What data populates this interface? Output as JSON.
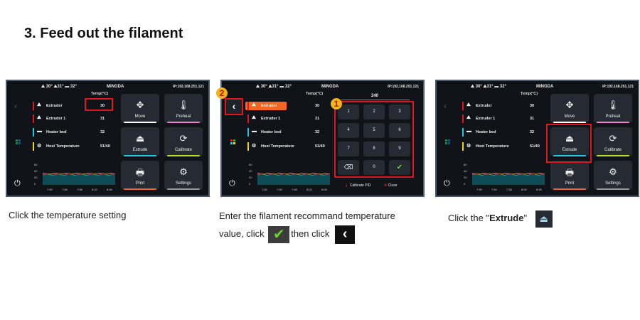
{
  "heading": "3.  Feed out the filament",
  "colors": {
    "screen_bg": "#101317",
    "tile_bg": "#262b33",
    "highlight": "#e0161e",
    "orange": "#f26522",
    "marker": "#f1b41a"
  },
  "screen": {
    "temps": "⛰ 30° ⛰31° ▬ 32°",
    "brand": "MINGDA",
    "ip": "IP:192.168.251.121",
    "temp_header": "Temp(°C)",
    "rows": [
      {
        "label": "Extruder",
        "value": "30",
        "bar_color": "#e0161e",
        "icon": "extruder-icon"
      },
      {
        "label": "Extruder 1",
        "value": "31",
        "bar_color": "#e0161e",
        "icon": "extruder-icon"
      },
      {
        "label": "Heater bed",
        "value": "32",
        "bar_color": "#1bc6e6",
        "icon": "heater-bed-icon"
      },
      {
        "label": "Host Temperature",
        "value": "51/40",
        "bar_color": "#f2d21a",
        "icon": "gear-icon"
      }
    ],
    "chart_y_ticks": [
      "60",
      "40",
      "20",
      "0"
    ],
    "chart_x_ticks": [
      "7:50",
      "7:54",
      "7:58",
      "8:02",
      "8:06"
    ],
    "tiles": [
      {
        "label": "Move",
        "color": "#ffffff"
      },
      {
        "label": "Preheat",
        "color": "#ee7fd0"
      },
      {
        "label": "Extrude",
        "color": "#1bc6e6"
      },
      {
        "label": "Calibrate",
        "color": "#b3e21a"
      },
      {
        "label": "Print",
        "color": "#f26522"
      },
      {
        "label": "Settings",
        "color": "#9b9b9b"
      }
    ]
  },
  "screen2": {
    "entry_value": "240",
    "keys": [
      "1",
      "2",
      "3",
      "4",
      "5",
      "6",
      "7",
      "8",
      "9",
      "⌫",
      "0",
      "✔"
    ],
    "calibrate_pid": "Calibrate PID",
    "close": "Close",
    "marker1": "1",
    "marker2": "2"
  },
  "captions": {
    "c1": "Click the temperature setting",
    "c2_line1": "Enter the filament recommand temperature",
    "c2_line2a": "value, click",
    "c2_line2b": "then click",
    "c3_prefix": "Click the \"",
    "c3_bold": "Extrude",
    "c3_suffix": "\""
  }
}
